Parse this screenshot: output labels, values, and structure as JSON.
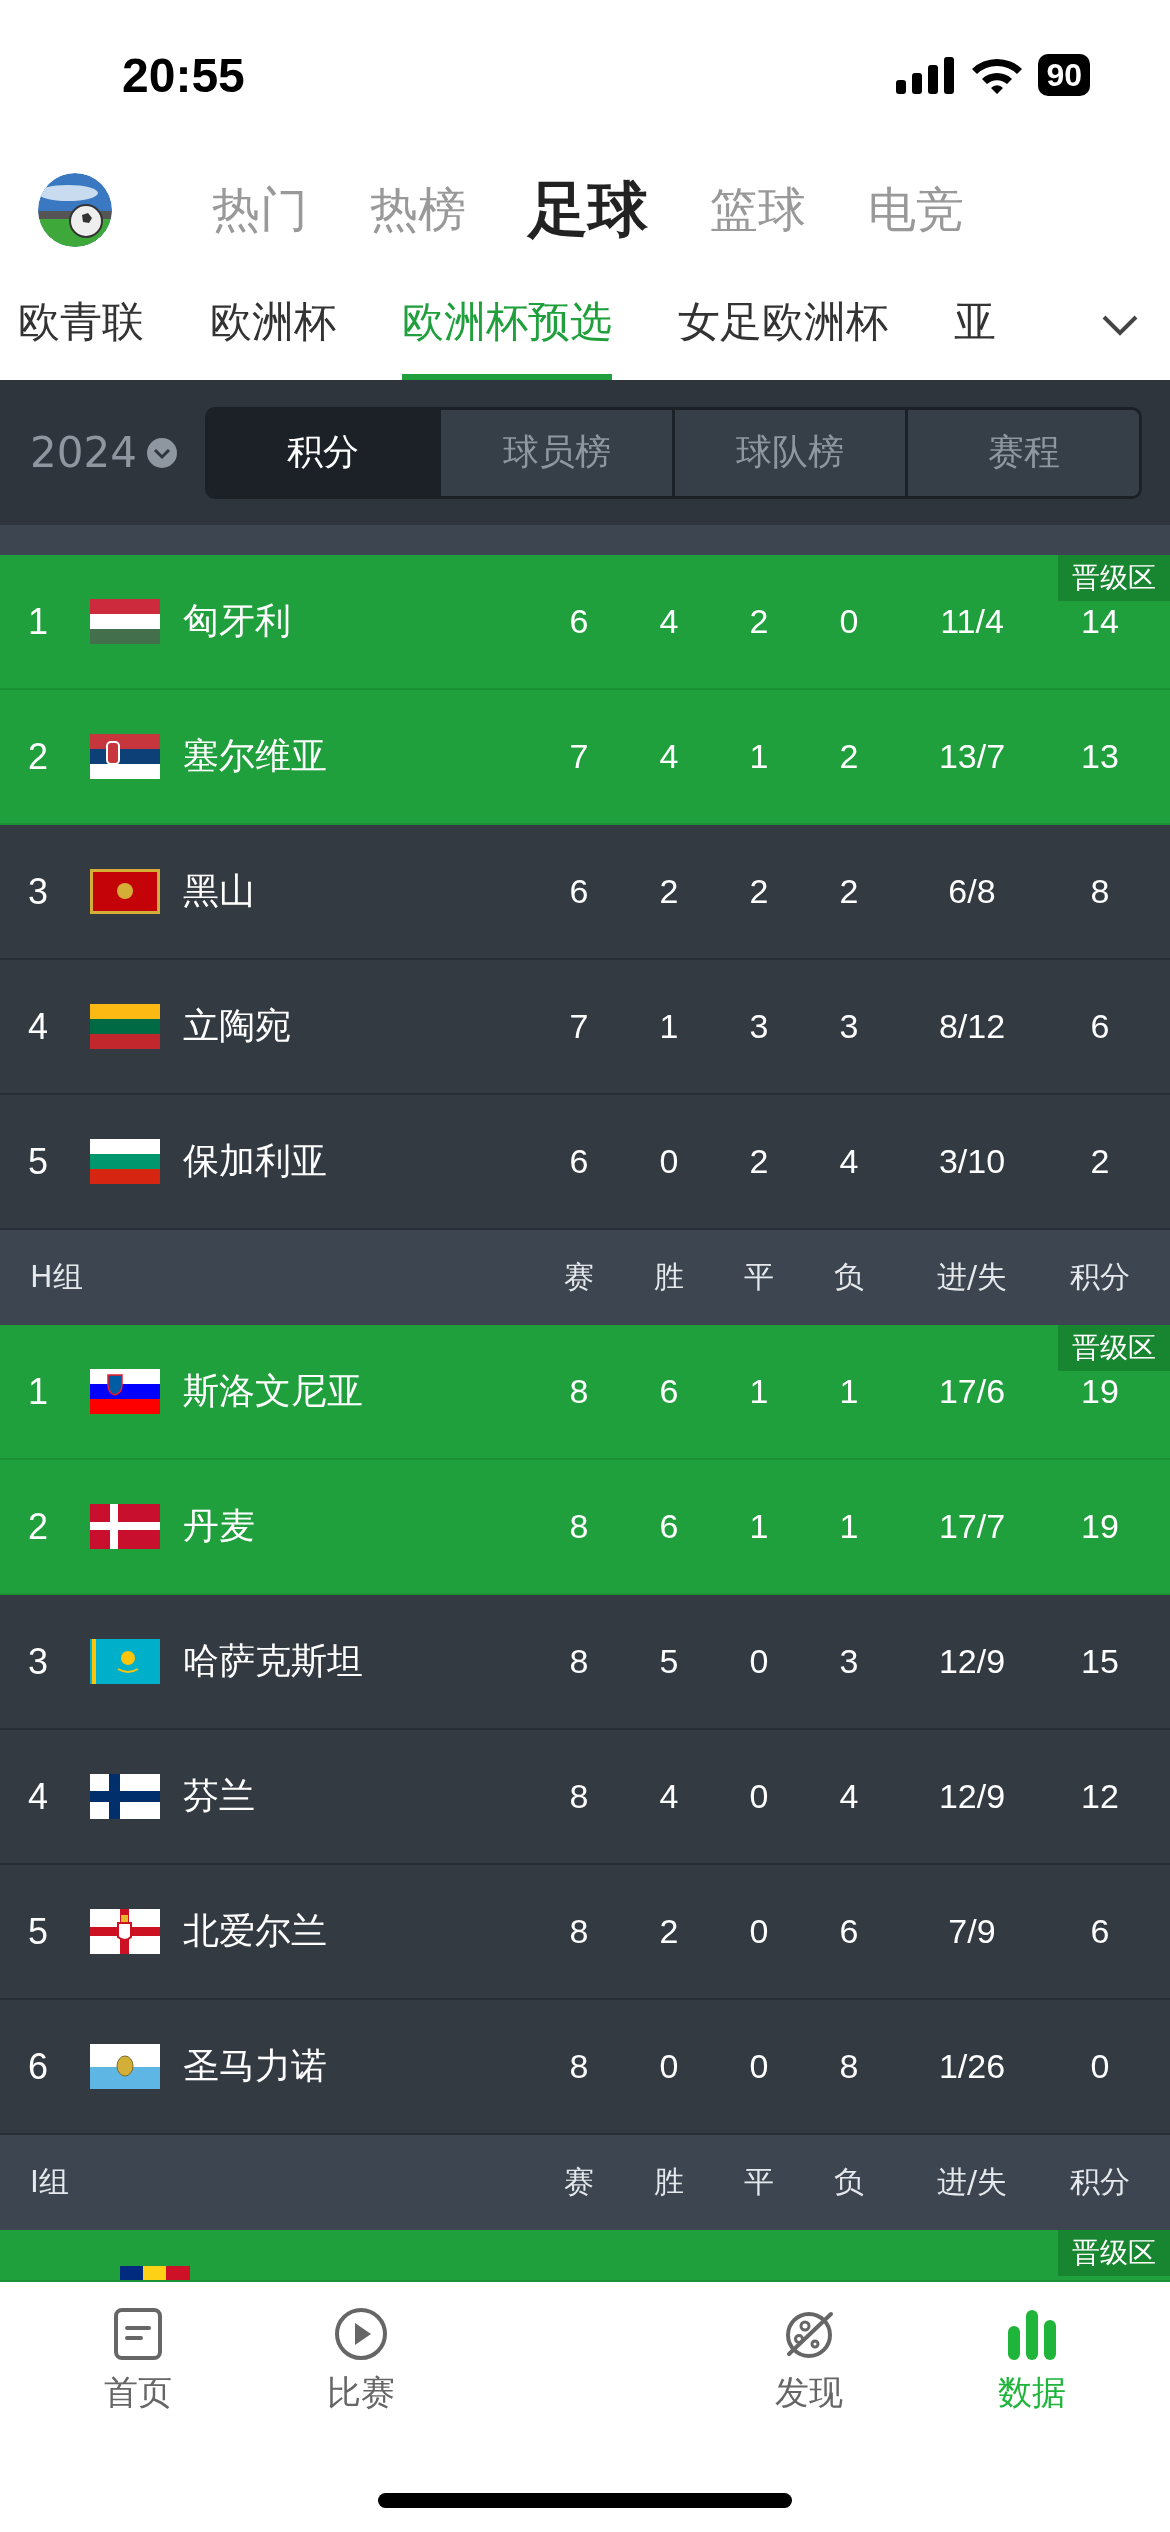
{
  "status_bar": {
    "time": "20:55",
    "battery": "90"
  },
  "top_tabs": [
    {
      "label": "热门",
      "selected": false
    },
    {
      "label": "热榜",
      "selected": false
    },
    {
      "label": "足球",
      "selected": true
    },
    {
      "label": "篮球",
      "selected": false
    },
    {
      "label": "电竞",
      "selected": false
    }
  ],
  "league_tabs": [
    {
      "label": "欧青联",
      "selected": false
    },
    {
      "label": "欧洲杯",
      "selected": false
    },
    {
      "label": "欧洲杯预选",
      "selected": true
    },
    {
      "label": "女足欧洲杯",
      "selected": false
    },
    {
      "label": "亚",
      "selected": false
    }
  ],
  "filter": {
    "season": "2024",
    "segments": [
      {
        "label": "积分",
        "selected": true
      },
      {
        "label": "球员榜",
        "selected": false
      },
      {
        "label": "球队榜",
        "selected": false
      },
      {
        "label": "赛程",
        "selected": false
      }
    ]
  },
  "groups": [
    {
      "rows": [
        {
          "rank": "1",
          "kind": "hu",
          "team": "匈牙利",
          "promoted": true,
          "badge": "晋级区",
          "stats": [
            "6",
            "4",
            "2",
            "0",
            "11/4",
            "14"
          ]
        },
        {
          "rank": "2",
          "kind": "rs",
          "team": "塞尔维亚",
          "promoted": true,
          "stats": [
            "7",
            "4",
            "1",
            "2",
            "13/7",
            "13"
          ]
        },
        {
          "rank": "3",
          "kind": "me",
          "team": "黑山",
          "promoted": false,
          "stats": [
            "6",
            "2",
            "2",
            "2",
            "6/8",
            "8"
          ]
        },
        {
          "rank": "4",
          "kind": "lt",
          "team": "立陶宛",
          "promoted": false,
          "stats": [
            "7",
            "1",
            "3",
            "3",
            "8/12",
            "6"
          ]
        },
        {
          "rank": "5",
          "kind": "bg",
          "team": "保加利亚",
          "promoted": false,
          "stats": [
            "6",
            "0",
            "2",
            "4",
            "3/10",
            "2"
          ]
        }
      ]
    },
    {
      "name": "H组",
      "columns": [
        "赛",
        "胜",
        "平",
        "负",
        "进/失",
        "积分"
      ],
      "rows": [
        {
          "rank": "1",
          "kind": "si",
          "team": "斯洛文尼亚",
          "promoted": true,
          "badge": "晋级区",
          "stats": [
            "8",
            "6",
            "1",
            "1",
            "17/6",
            "19"
          ]
        },
        {
          "rank": "2",
          "kind": "dk",
          "team": "丹麦",
          "promoted": true,
          "stats": [
            "8",
            "6",
            "1",
            "1",
            "17/7",
            "19"
          ]
        },
        {
          "rank": "3",
          "kind": "kz",
          "team": "哈萨克斯坦",
          "promoted": false,
          "stats": [
            "8",
            "5",
            "0",
            "3",
            "12/9",
            "15"
          ]
        },
        {
          "rank": "4",
          "kind": "fi",
          "team": "芬兰",
          "promoted": false,
          "stats": [
            "8",
            "4",
            "0",
            "4",
            "12/9",
            "12"
          ]
        },
        {
          "rank": "5",
          "kind": "nir",
          "team": "北爱尔兰",
          "promoted": false,
          "stats": [
            "8",
            "2",
            "0",
            "6",
            "7/9",
            "6"
          ]
        },
        {
          "rank": "6",
          "kind": "sm",
          "team": "圣马力诺",
          "promoted": false,
          "stats": [
            "8",
            "0",
            "0",
            "8",
            "1/26",
            "0"
          ]
        }
      ]
    },
    {
      "name": "I组",
      "columns": [
        "赛",
        "胜",
        "平",
        "负",
        "进/失",
        "积分"
      ],
      "rows": [
        {
          "kind": "ro",
          "promoted": true,
          "badge": "晋级区"
        }
      ]
    }
  ],
  "bottom_nav": [
    {
      "label": "首页",
      "kind": "doc",
      "selected": false
    },
    {
      "label": "比赛",
      "kind": "play",
      "selected": false
    },
    {
      "label": "发现",
      "kind": "planet",
      "selected": false
    },
    {
      "label": "数据",
      "kind": "bars",
      "selected": true
    }
  ]
}
